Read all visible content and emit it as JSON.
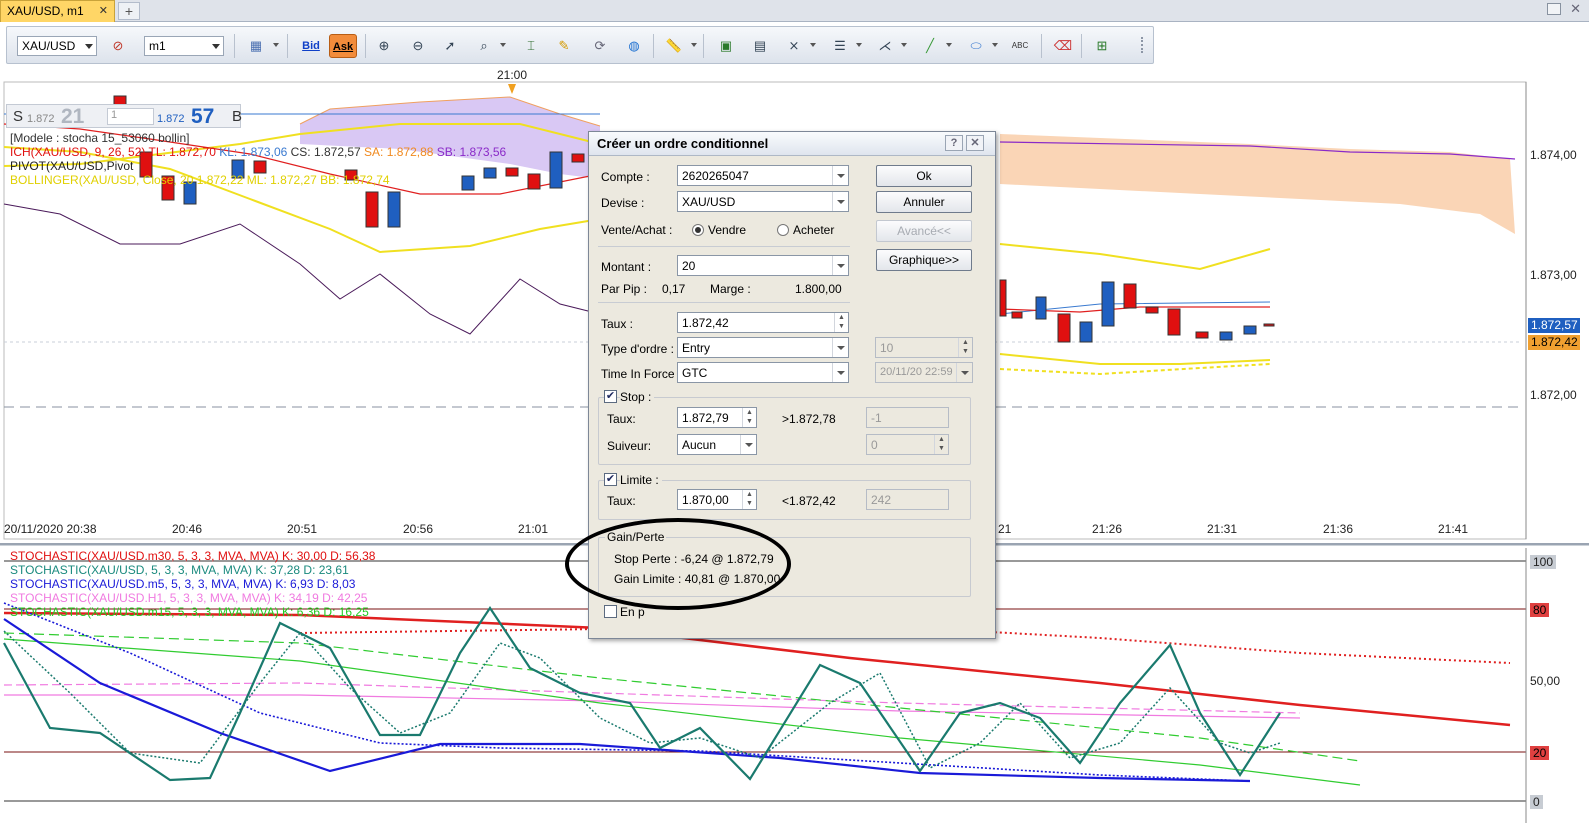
{
  "tab": {
    "label": "XAU/USD, m1",
    "close": "✕",
    "add": "+"
  },
  "toolbar": {
    "symbol": "XAU/USD",
    "timeframe": "m1",
    "bid_label": "Bid",
    "ask_label": "Ask"
  },
  "quote": {
    "sell_letter": "S",
    "sell_small": "1.872",
    "sell_big": "21",
    "qty": "1",
    "buy_small": "1.872",
    "buy_big": "57",
    "buy_letter": "B"
  },
  "legend": {
    "modele": "[Modele : stocha 15_53060 bollin]",
    "ich": "ICH(XAU/USD, 9, 26, 52)",
    "tl": "TL: 1.872,70",
    "kl": "KL: 1.873,06",
    "cs": "CS: 1.872,57",
    "sa": "SA: 1.872,88",
    "sb": "SB: 1.873,56",
    "pivot": "PIVOT(XAU/USD,Pivot",
    "bollinger": "BOLLINGER(XAU/USD, Close, 20",
    "boll_values": "1.872,22  ML: 1.872,27  BB: 1.872,74"
  },
  "price_axis": [
    "1.874,00",
    "1.873,00",
    "1.872,00"
  ],
  "price_tags": {
    "ask": "1.872,57",
    "bid": "1.872,42"
  },
  "marker_time": "21:00",
  "time_axis": [
    "20/11/2020 20:38",
    "20:46",
    "20:51",
    "20:56",
    "21:01",
    "21",
    "21:26",
    "21:31",
    "21:36",
    "21:41"
  ],
  "stoch_legend": [
    {
      "text": "STOCHASTIC(XAU/USD.m30, 5, 3, 3, MVA, MVA)  K: 30,00  D: 56,38",
      "color": "#e01010"
    },
    {
      "text": "STOCHASTIC(XAU/USD, 5, 3, 3, MVA, MVA)  K: 37,28  D: 23,61",
      "color": "#1a8a7e"
    },
    {
      "text": "STOCHASTIC(XAU/USD.m5, 5, 3, 3, MVA, MVA)  K: 6,93  D: 8,03",
      "color": "#1a1ad8"
    },
    {
      "text": "STOCHASTIC(XAU/USD.H1, 5, 3, 3, MVA, MVA)  K: 34,19  D: 42,25",
      "color": "#f07ae0"
    },
    {
      "text": "STOCHASTIC(XAU/USD.m15, 5, 3, 3, MVA, MVA)  K: 6,36  D: 16,25",
      "color": "#22cc22"
    }
  ],
  "stoch_axis": {
    "top": "100",
    "upper": "80",
    "mid": "50,00",
    "lower": "20",
    "bottom": "0"
  },
  "dialog": {
    "title": "Créer un ordre conditionnel",
    "help": "?",
    "close": "✕",
    "compte_label": "Compte :",
    "compte_value": "2620265047",
    "devise_label": "Devise :",
    "devise_value": "XAU/USD",
    "vente_achat_label": "Vente/Achat :",
    "vendre": "Vendre",
    "acheter": "Acheter",
    "montant_label": "Montant :",
    "montant_value": "20",
    "par_pip_label": "Par Pip :",
    "par_pip_value": "0,17",
    "marge_label": "Marge :",
    "marge_value": "1.800,00",
    "taux_label": "Taux :",
    "taux_value": "1.872,42",
    "type_label": "Type d'ordre :",
    "type_value": "Entry",
    "type_extra": "10",
    "tif_label": "Time In Force :",
    "tif_value": "GTC",
    "tif_date": "20/11/20 22:59",
    "stop_label": "Stop :",
    "stop_taux_label": "Taux:",
    "stop_taux_value": "1.872,79",
    "stop_ref": ">1.872,78",
    "stop_pips": "-1",
    "suiveur_label": "Suiveur:",
    "suiveur_value": "Aucun",
    "suiveur_pips": "0",
    "limite_label": "Limite :",
    "limite_taux_label": "Taux:",
    "limite_taux_value": "1.870,00",
    "limite_ref": "<1.872,42",
    "limite_pips": "242",
    "gain_header": "Gain/Perte",
    "stop_perte": "Stop Perte : -6,24 @ 1.872,79",
    "gain_limite": "Gain Limite : 40,81 @ 1.870,00",
    "hidden_check": "En p",
    "btn_ok": "Ok",
    "btn_annuler": "Annuler",
    "btn_avance": "Avancé<<",
    "btn_graphique": "Graphique>>"
  }
}
